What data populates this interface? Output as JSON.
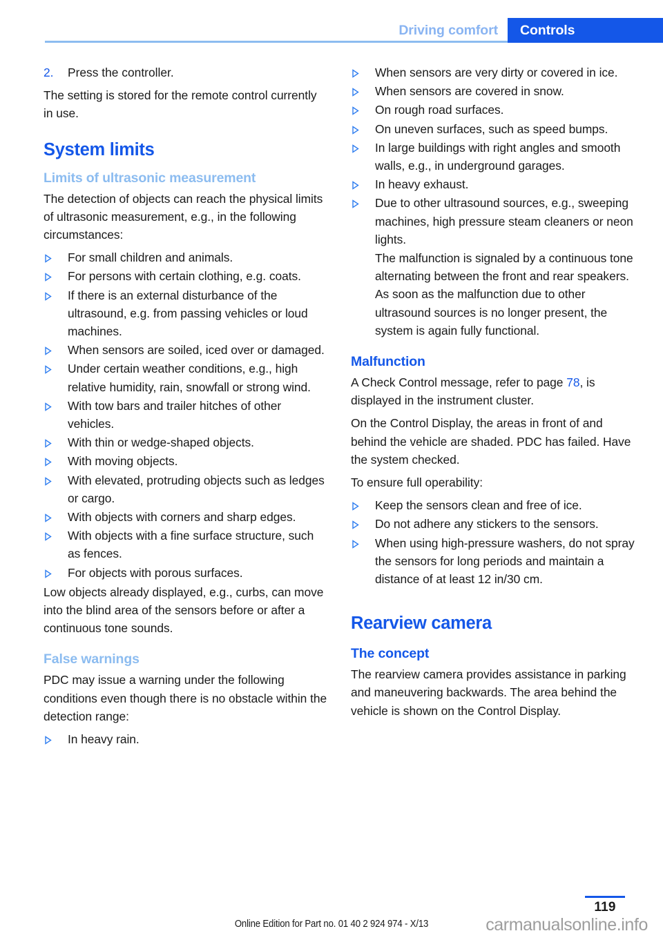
{
  "header": {
    "tab_inactive": "Driving comfort",
    "tab_active": "Controls",
    "accent_blue": "#1457e8",
    "light_blue": "#8cbcf0"
  },
  "left_column": {
    "step": {
      "number": "2.",
      "text": "Press the controller."
    },
    "para_setting": "The setting is stored for the remote control currently in use.",
    "heading_system_limits": "System limits",
    "heading_limits_ultrasonic": "Limits of ultrasonic measurement",
    "para_detection": "The detection of objects can reach the physical limits of ultrasonic measurement, e.g., in the following circumstances:",
    "limits_bullets": [
      "For small children and animals.",
      "For persons with certain clothing, e.g. coats.",
      "If there is an external disturbance of the ultrasound, e.g. from passing vehicles or loud machines.",
      "When sensors are soiled, iced over or damaged.",
      "Under certain weather conditions, e.g., high relative humidity, rain, snowfall or strong wind.",
      "With tow bars and trailer hitches of other vehicles.",
      "With thin or wedge-shaped objects.",
      "With moving objects.",
      "With elevated, protruding objects such as ledges or cargo.",
      "With objects with corners and sharp edges.",
      "With objects with a fine surface structure, such as fences.",
      "For objects with porous surfaces."
    ],
    "para_low_objects": "Low objects already displayed, e.g., curbs, can move into the blind area of the sensors before or after a continuous tone sounds.",
    "heading_false_warnings": "False warnings",
    "para_pdc_warning": "PDC may issue a warning under the following conditions even though there is no obstacle within the detection range:",
    "false_bullets_left": [
      "In heavy rain."
    ]
  },
  "right_column": {
    "false_bullets_right": [
      "When sensors are very dirty or covered in ice.",
      "When sensors are covered in snow.",
      "On rough road surfaces.",
      "On uneven surfaces, such as speed bumps.",
      "In large buildings with right angles and smooth walls, e.g., in underground garages.",
      "In heavy exhaust.",
      "Due to other ultrasound sources, e.g., sweeping machines, high pressure steam cleaners or neon lights."
    ],
    "bullet_continuation": "The malfunction is signaled by a continuous tone alternating between the front and rear speakers. As soon as the malfunction due to other ultrasound sources is no longer present, the system is again fully functional.",
    "heading_malfunction": "Malfunction",
    "para_check_control_pre": "A Check Control message, refer to page ",
    "para_check_control_ref": "78",
    "para_check_control_post": ", is displayed in the instrument cluster.",
    "para_control_display": "On the Control Display, the areas in front of and behind the vehicle are shaded. PDC has failed. Have the system checked.",
    "para_ensure": "To ensure full operability:",
    "operability_bullets": [
      "Keep the sensors clean and free of ice.",
      "Do not adhere any stickers to the sensors.",
      "When using high-pressure washers, do not spray the sensors for long periods and maintain a distance of at least 12 in/30 cm."
    ],
    "heading_rearview_camera": "Rearview camera",
    "heading_the_concept": "The concept",
    "para_rearview": "The rearview camera provides assistance in parking and maneuvering backwards. The area behind the vehicle is shown on the Control Display."
  },
  "footer": {
    "page_number": "119",
    "edition": "Online Edition for Part no. 01 40 2 924 974 - X/13",
    "watermark": "carmanualsonline.info"
  }
}
